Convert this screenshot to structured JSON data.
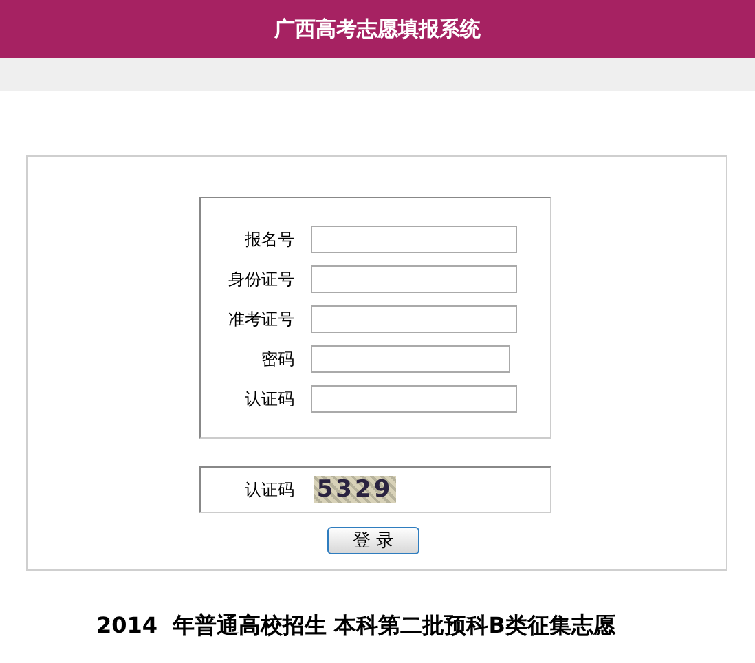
{
  "header": {
    "title": "广西高考志愿填报系统"
  },
  "form": {
    "fields": [
      {
        "label": "报名号",
        "kind": "text"
      },
      {
        "label": "身份证号",
        "kind": "text"
      },
      {
        "label": "准考证号",
        "kind": "text"
      },
      {
        "label": "密码",
        "kind": "password"
      },
      {
        "label": "认证码",
        "kind": "text"
      }
    ]
  },
  "captcha": {
    "label": "认证码",
    "code": "5329"
  },
  "login_button": "登 录",
  "notice": "2014  年普通高校招生 本科第二批预科B类征集志愿"
}
